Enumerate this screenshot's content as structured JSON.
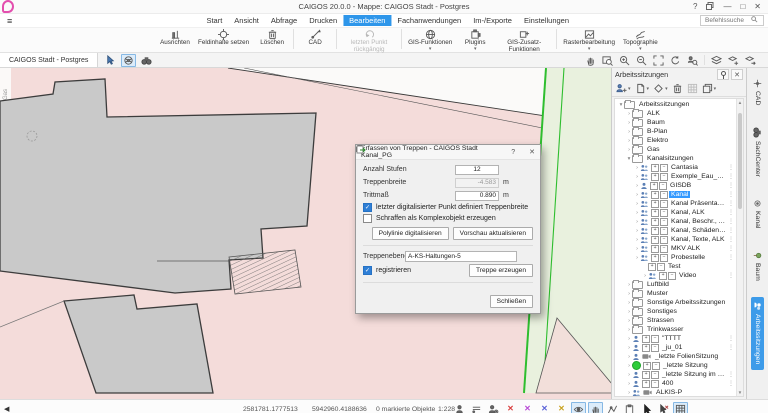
{
  "window": {
    "title": "CAIGOS 20.0.0  -  Mappe: CAIGOS Stadt - Postgres",
    "help": "?",
    "controls": [
      "windows-icon",
      "minimize",
      "maximize",
      "close"
    ]
  },
  "menu": {
    "tabs": [
      "Start",
      "Ansicht",
      "Abfrage",
      "Drucken",
      "Bearbeiten",
      "Fachanwendungen",
      "Im-/Exporte",
      "Einstellungen"
    ],
    "active_tab": "Bearbeiten",
    "search_placeholder": "Befehlssuche",
    "search_icon": "magnifier-icon"
  },
  "ribbon": {
    "buttons": [
      {
        "label": "Ausrichten",
        "icon": "align-icon"
      },
      {
        "label": "Feldinhalte setzen",
        "icon": "target-icon"
      },
      {
        "label": "Löschen",
        "icon": "trash-icon"
      },
      {
        "sep": true
      },
      {
        "label": "CAD",
        "icon": "cad-icon"
      },
      {
        "sep": true
      },
      {
        "label": "letzten Punkt rückgängig",
        "icon": "undo-icon",
        "disabled": true
      },
      {
        "sep": true
      },
      {
        "label": "GIS-Funktionen",
        "icon": "globe-icon",
        "dd": true
      },
      {
        "label": "Plugins",
        "icon": "plugin-icon",
        "dd": true
      },
      {
        "label": "GIS-Zusatz-Funktionen",
        "icon": "plugin-plus-icon",
        "dd": true
      },
      {
        "sep": true
      },
      {
        "label": "Rasterbearbeitung",
        "icon": "raster-icon",
        "dd": true
      },
      {
        "label": "Topographie",
        "icon": "topo-icon",
        "dd": true
      }
    ]
  },
  "docbar": {
    "tab": "CAIGOS Stadt - Postgres",
    "left_tools": [
      {
        "name": "select-cursor-icon",
        "icon": "cursor-dd-icon"
      },
      {
        "name": "layer-globe-icon",
        "icon": "net-globe-icon",
        "pressed": true
      },
      {
        "name": "binoculars-icon",
        "icon": "binoculars-icon"
      }
    ],
    "right_tools": [
      {
        "name": "pan-icon",
        "icon": "hand-icon"
      },
      {
        "name": "zoom-window-icon",
        "icon": "zoomrect-icon"
      },
      {
        "name": "zoom-in-icon",
        "icon": "zoomin-icon"
      },
      {
        "name": "zoom-out-icon",
        "icon": "zoomout-icon"
      },
      {
        "name": "zoom-extent-icon",
        "icon": "extent-icon"
      },
      {
        "name": "refresh-icon",
        "icon": "refresh-icon"
      },
      {
        "name": "zoom-selection-icon",
        "icon": "personzoom-icon"
      },
      {
        "sep": true
      },
      {
        "name": "layers-icon",
        "icon": "layers-icon"
      },
      {
        "name": "layer-add-icon",
        "icon": "layeradd-icon"
      },
      {
        "name": "layer-move-icon",
        "icon": "layermove-icon"
      }
    ]
  },
  "map": {
    "street_label": "Gas",
    "colors": {
      "background_pink": "#f4dcda",
      "area_green": "#e9f1de",
      "green_line": "#2fbe2f",
      "building_gray": "#c9c9c9",
      "building_outline": "#3c3c3c"
    }
  },
  "dialog": {
    "title": "Erfassen von Treppen - CAIGOS Stadt Kanal_PG",
    "help": "?",
    "anzahl_label": "Anzahl Stufen",
    "anzahl_value": "12",
    "breite_label": "Treppenbreite",
    "breite_value": "-4.583",
    "breite_unit": "m",
    "tritt_label": "Trittmaß",
    "tritt_value": "0.890",
    "tritt_unit": "m",
    "check_punkt_label": "letzter digitalisierter Punkt definiert Treppenbreite",
    "check_punkt_checked": true,
    "check_schraffen_label": "Schraffen als Komplexobjekt erzeugen",
    "check_schraffen_checked": false,
    "btn_polylinie": "Polylinie digitalisieren",
    "btn_vorschau": "Vorschau aktualisieren",
    "ebene_label": "Treppenebene",
    "ebene_value": "A-KS-Haltungen-5",
    "browse_icon": "browse-file-icon",
    "check_registrieren_label": "registrieren",
    "check_registrieren_checked": true,
    "btn_treppe": "Treppe erzeugen",
    "btn_schliessen": "Schließen"
  },
  "panel": {
    "title": "Arbeitssitzungen",
    "pin_icon": "pin-icon",
    "close_icon": "close-icon",
    "toolbar": [
      {
        "name": "add-user-session-icon",
        "icon": "person-add-icon",
        "dd": true
      },
      {
        "name": "new-document-icon",
        "icon": "doc-icon",
        "dd": true
      },
      {
        "name": "diamond-icon",
        "icon": "diamond-icon",
        "dd": true
      },
      {
        "name": "delete-icon",
        "icon": "trash-icon"
      },
      {
        "name": "grid-icon",
        "icon": "grid-icon",
        "disabled": true
      },
      {
        "name": "copy-session-icon",
        "icon": "copy-icon",
        "dd": true
      }
    ],
    "tree": [
      {
        "l": 0,
        "t": "folder",
        "label": "Arbeitssitzungen",
        "exp": true
      },
      {
        "l": 1,
        "t": "folder",
        "label": "ALK"
      },
      {
        "l": 1,
        "t": "folder",
        "label": "Baum"
      },
      {
        "l": 1,
        "t": "folder",
        "label": "B-Plan"
      },
      {
        "l": 1,
        "t": "folder",
        "label": "Elektro"
      },
      {
        "l": 1,
        "t": "folder",
        "label": "Gas"
      },
      {
        "l": 1,
        "t": "folder",
        "label": "Kanalsitzungen",
        "exp": true
      },
      {
        "l": 2,
        "t": "s2",
        "label": "Cantasia",
        "m": true
      },
      {
        "l": 2,
        "t": "s2",
        "label": "Exemple_Eau_Ass",
        "m": true
      },
      {
        "l": 2,
        "t": "s1",
        "label": "GISDB",
        "m": true
      },
      {
        "l": 2,
        "t": "s2",
        "label": "Kanal",
        "m": true,
        "sel": true
      },
      {
        "l": 2,
        "t": "s2",
        "label": "Kanal Präsentation",
        "m": true
      },
      {
        "l": 2,
        "t": "s2",
        "label": "Kanal, ALK",
        "m": true
      },
      {
        "l": 2,
        "t": "s2",
        "label": "Kanal, Beschr., ALK",
        "m": true
      },
      {
        "l": 2,
        "t": "s2",
        "label": "Kanal, Schäden, ALK",
        "m": true
      },
      {
        "l": 2,
        "t": "s2",
        "label": "Kanal, Texte, ALK",
        "m": true
      },
      {
        "l": 2,
        "t": "s2",
        "label": "MKV ALK",
        "m": true
      },
      {
        "l": 2,
        "t": "s2",
        "label": "Probestelle",
        "m": true
      },
      {
        "l": 3,
        "t": "plain",
        "label": "Test"
      },
      {
        "l": 3,
        "t": "s2",
        "label": "Video",
        "m": true
      },
      {
        "l": 1,
        "t": "folder",
        "label": "Luftbild"
      },
      {
        "l": 1,
        "t": "folder",
        "label": "Muster"
      },
      {
        "l": 1,
        "t": "folder",
        "label": "Sonstige Arbeitssitzungen"
      },
      {
        "l": 1,
        "t": "folder",
        "label": "Sonstiges"
      },
      {
        "l": 1,
        "t": "folder",
        "label": "Strassen"
      },
      {
        "l": 1,
        "t": "folder",
        "label": "Trinkwasser"
      },
      {
        "l": 1,
        "t": "s1",
        "label": "\"TTTT",
        "m": true
      },
      {
        "l": 1,
        "t": "s1",
        "label": "_ju_01",
        "m": true
      },
      {
        "l": 1,
        "t": "cam1",
        "label": "_letzte FolienSitzung"
      },
      {
        "l": 1,
        "t": "green",
        "label": "_letzte Sitzung"
      },
      {
        "l": 1,
        "t": "s1",
        "label": "_letzte Sitzung im Internet",
        "m": true
      },
      {
        "l": 1,
        "t": "s1",
        "label": "400",
        "m": true
      },
      {
        "l": 1,
        "t": "cam2",
        "label": "ALKIS-P"
      }
    ]
  },
  "side_tabs": [
    {
      "label": "CAD",
      "icon": "cad-cross-icon"
    },
    {
      "label": "SachCenter",
      "icon": "binoculars-icon"
    },
    {
      "label": "Kanal",
      "icon": "ring-icon"
    },
    {
      "label": "Baum",
      "icon": "tree-icon"
    },
    {
      "label": "Arbeitssitzungen",
      "icon": "people-icon",
      "active": true
    }
  ],
  "statusbar": {
    "back_arrow": "◀",
    "coord_x": "2581781.1777513",
    "coord_y": "5942960.4188636",
    "objects": "0 markierte Objekte",
    "scale": "1:228",
    "icons": [
      {
        "name": "point-info-icon",
        "icon": "personpt-icon"
      },
      {
        "name": "layer-list-icon",
        "icon": "bars-icon"
      },
      {
        "name": "settings-person-icon",
        "icon": "persongear-icon"
      },
      {
        "name": "snap-point-icon",
        "glyph": "✕",
        "color": "#d94040"
      },
      {
        "name": "snap-line-icon",
        "glyph": "✕",
        "color": "#b84ad6"
      },
      {
        "name": "snap-intersection-icon",
        "glyph": "✕",
        "color": "#5a62d8"
      },
      {
        "name": "snap-grid-icon",
        "glyph": "✕",
        "color": "#c8a21e"
      },
      {
        "name": "visibility-icon",
        "icon": "eye-icon",
        "pressed": true
      },
      {
        "name": "pan-lock-icon",
        "icon": "hand-icon",
        "pressed": true
      },
      {
        "name": "polyline-icon",
        "icon": "polyline-icon"
      },
      {
        "name": "clipboard-icon",
        "icon": "clipboard-icon"
      },
      {
        "name": "cursor-icon",
        "icon": "cursorb-icon"
      },
      {
        "name": "cursor-delete-icon",
        "icon": "cursorx-icon"
      },
      {
        "name": "grid-snap-icon",
        "icon": "grid-icon",
        "pressed": true
      }
    ]
  }
}
